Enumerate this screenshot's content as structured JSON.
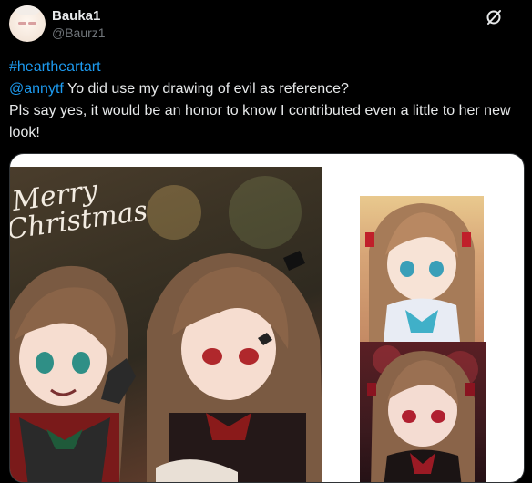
{
  "tweet": {
    "author_name": "Bauka1",
    "author_handle": "@Baurz1",
    "hashtag": "#heartheartart",
    "mention": "@annytf",
    "line1_rest": " Yo did use my drawing of evil as reference?",
    "line2": "Pls say yes, it would be an honor to know I contributed even a little to her new look!",
    "grok_icon": "grok-icon"
  },
  "media": {
    "main_image_text": "Merry Christmas",
    "images": [
      "main-artwork",
      "thumbnail-character-1",
      "thumbnail-character-2"
    ]
  },
  "colors": {
    "background": "#000000",
    "text": "#e7e9ea",
    "secondary_text": "#71767b",
    "link": "#1d9bf0"
  }
}
